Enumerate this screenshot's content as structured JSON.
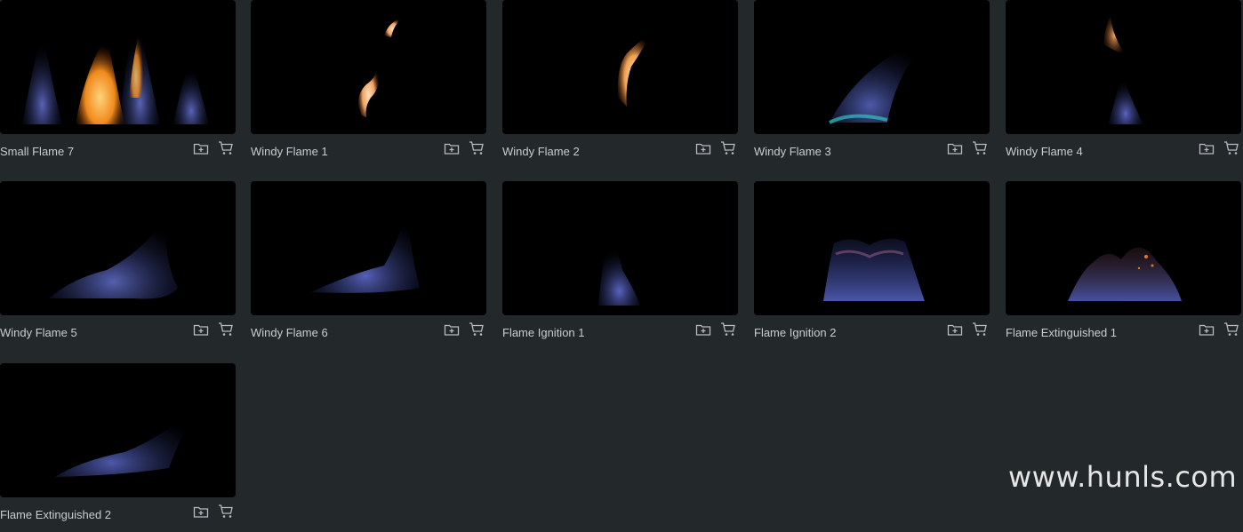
{
  "items": [
    {
      "title": "Small Flame 7"
    },
    {
      "title": "Windy Flame 1"
    },
    {
      "title": "Windy Flame 2"
    },
    {
      "title": "Windy Flame 3"
    },
    {
      "title": "Windy Flame 4"
    },
    {
      "title": "Windy Flame 5"
    },
    {
      "title": "Windy Flame 6"
    },
    {
      "title": "Flame Ignition 1"
    },
    {
      "title": "Flame Ignition 2"
    },
    {
      "title": "Flame Extinguished 1"
    },
    {
      "title": "Flame Extinguished 2"
    }
  ],
  "watermark": "www.hunls.com",
  "icons": {
    "add": "folder-plus-icon",
    "cart": "cart-icon"
  },
  "colors": {
    "background": "#23282b",
    "thumb": "#000000",
    "caption": "#c9cdd0",
    "icon": "#b8bcbf"
  }
}
